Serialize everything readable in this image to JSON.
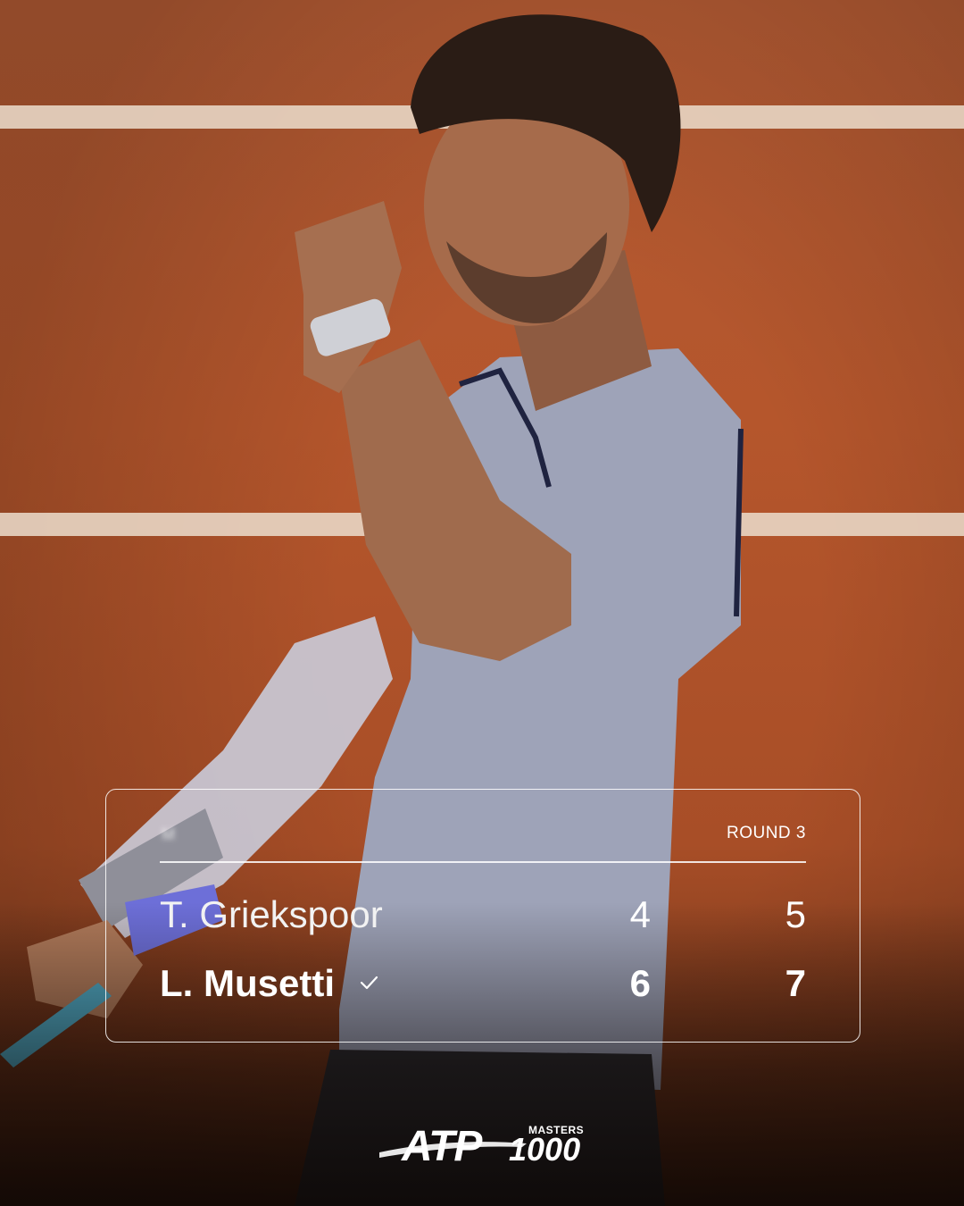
{
  "match": {
    "event_name": "M",
    "round": "ROUND 3",
    "players": [
      {
        "name": "T. Griekspoor",
        "sets": [
          "4",
          "5"
        ],
        "winner": false
      },
      {
        "name": "L. Musetti",
        "sets": [
          "6",
          "7"
        ],
        "winner": true
      }
    ]
  },
  "logo": {
    "brand": "ATP",
    "tier_label": "MASTERS",
    "tier_number": "1000"
  },
  "colors": {
    "clay": "#b5552c",
    "court_line": "#e9d9c8",
    "shirt": "#9ea3b8",
    "text": "#ffffff"
  }
}
